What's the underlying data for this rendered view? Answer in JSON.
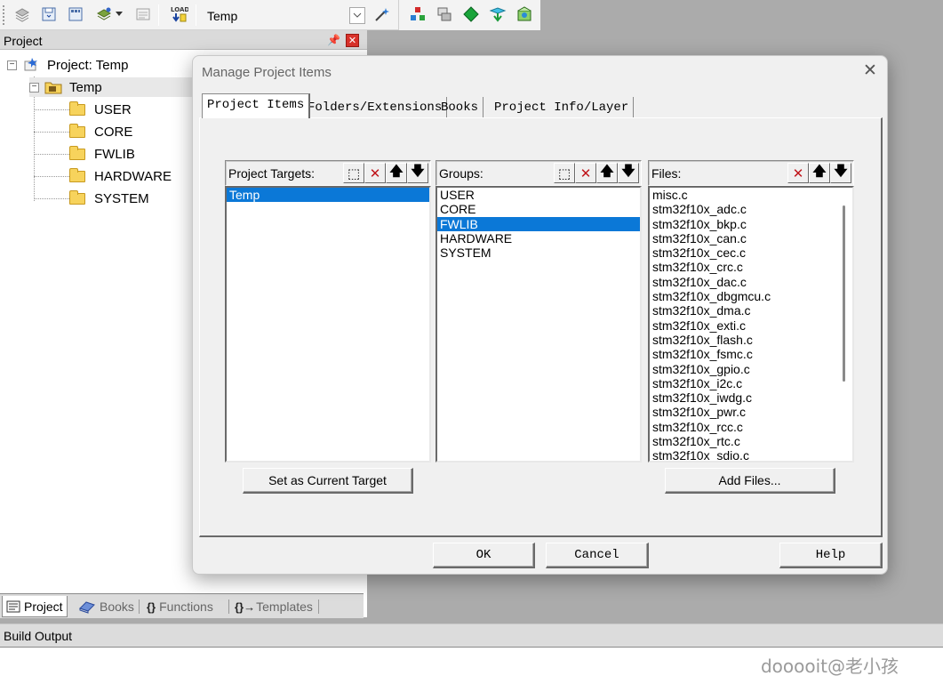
{
  "toolbar": {
    "target_name": "Temp",
    "icons": [
      "stack-icon",
      "save-icon",
      "save-all-icon",
      "build-icon",
      "dropdown-arrow",
      "batch-icon",
      "load-icon",
      "magic-wand-icon",
      "manage-components-icon",
      "layers-icon",
      "diamond-icon",
      "cube-icon",
      "pack-icon"
    ]
  },
  "project_panel": {
    "title": "Project",
    "root": "Project: Temp",
    "target": "Temp",
    "groups": [
      "USER",
      "CORE",
      "FWLIB",
      "HARDWARE",
      "SYSTEM"
    ],
    "tabs": [
      {
        "icon": "project-icon",
        "label": "Project"
      },
      {
        "icon": "books-icon",
        "label": "Books"
      },
      {
        "icon": "{}",
        "label": "Functions"
      },
      {
        "icon": "{}→",
        "label": "Templates"
      }
    ]
  },
  "build_output": {
    "title": "Build Output"
  },
  "watermark": "dooooit@老小孩",
  "dialog": {
    "title": "Manage Project Items",
    "close_glyph": "✕",
    "tabs": [
      "Project Items",
      "Folders/Extensions",
      "Books",
      "Project Info/Layer"
    ],
    "targets": {
      "header": "Project Targets:",
      "items": [
        "Temp"
      ],
      "selected": "Temp"
    },
    "groups": {
      "header": "Groups:",
      "items": [
        "USER",
        "CORE",
        "FWLIB",
        "HARDWARE",
        "SYSTEM"
      ],
      "selected": "FWLIB"
    },
    "files": {
      "header": "Files:",
      "items": [
        "misc.c",
        "stm32f10x_adc.c",
        "stm32f10x_bkp.c",
        "stm32f10x_can.c",
        "stm32f10x_cec.c",
        "stm32f10x_crc.c",
        "stm32f10x_dac.c",
        "stm32f10x_dbgmcu.c",
        "stm32f10x_dma.c",
        "stm32f10x_exti.c",
        "stm32f10x_flash.c",
        "stm32f10x_fsmc.c",
        "stm32f10x_gpio.c",
        "stm32f10x_i2c.c",
        "stm32f10x_iwdg.c",
        "stm32f10x_pwr.c",
        "stm32f10x_rcc.c",
        "stm32f10x_rtc.c",
        "stm32f10x_sdio.c"
      ]
    },
    "tool_glyphs": {
      "new": "⬚",
      "delete": "✕",
      "up": "🡅",
      "down": "🡇"
    },
    "buttons": {
      "set_current_target": "Set as Current Target",
      "add_files": "Add Files...",
      "ok": "OK",
      "cancel": "Cancel",
      "help": "Help"
    }
  }
}
